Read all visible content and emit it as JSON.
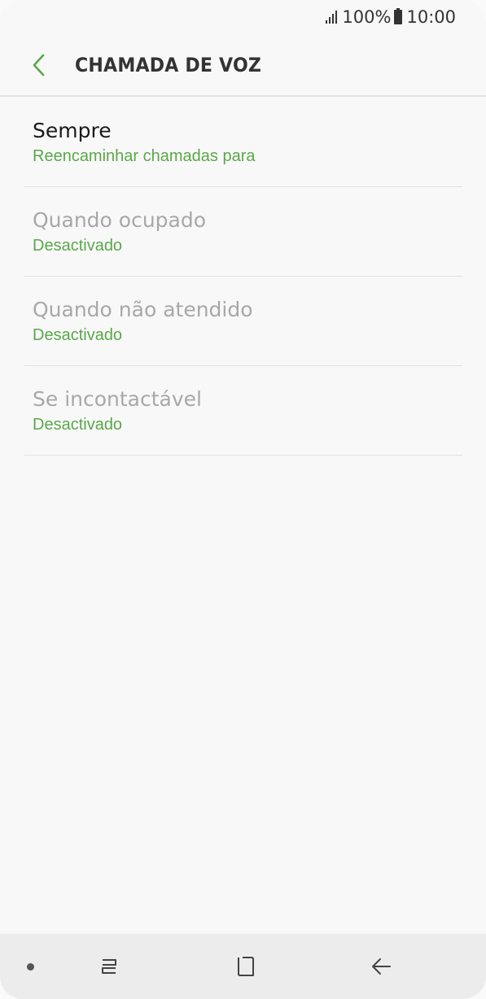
{
  "status_bar": {
    "battery": "100%",
    "time": "10:00"
  },
  "header": {
    "title": "CHAMADA DE VOZ",
    "back_icon": "chevron-left-icon"
  },
  "items": [
    {
      "title": "Sempre",
      "subtitle": "Reencaminhar chamadas para",
      "enabled": true
    },
    {
      "title": "Quando ocupado",
      "subtitle": "Desactivado",
      "enabled": false
    },
    {
      "title": "Quando não atendido",
      "subtitle": "Desactivado",
      "enabled": false
    },
    {
      "title": "Se incontactável",
      "subtitle": "Desactivado",
      "enabled": false
    }
  ],
  "nav_bar": {
    "icons": [
      "dot-icon",
      "recent-apps-icon",
      "home-icon",
      "back-arrow-icon"
    ]
  },
  "colors": {
    "accent": "#4caf50",
    "subtitle_green": "#5aa84a",
    "title_text": "#333333",
    "disabled_text": "#a8a8a8"
  }
}
